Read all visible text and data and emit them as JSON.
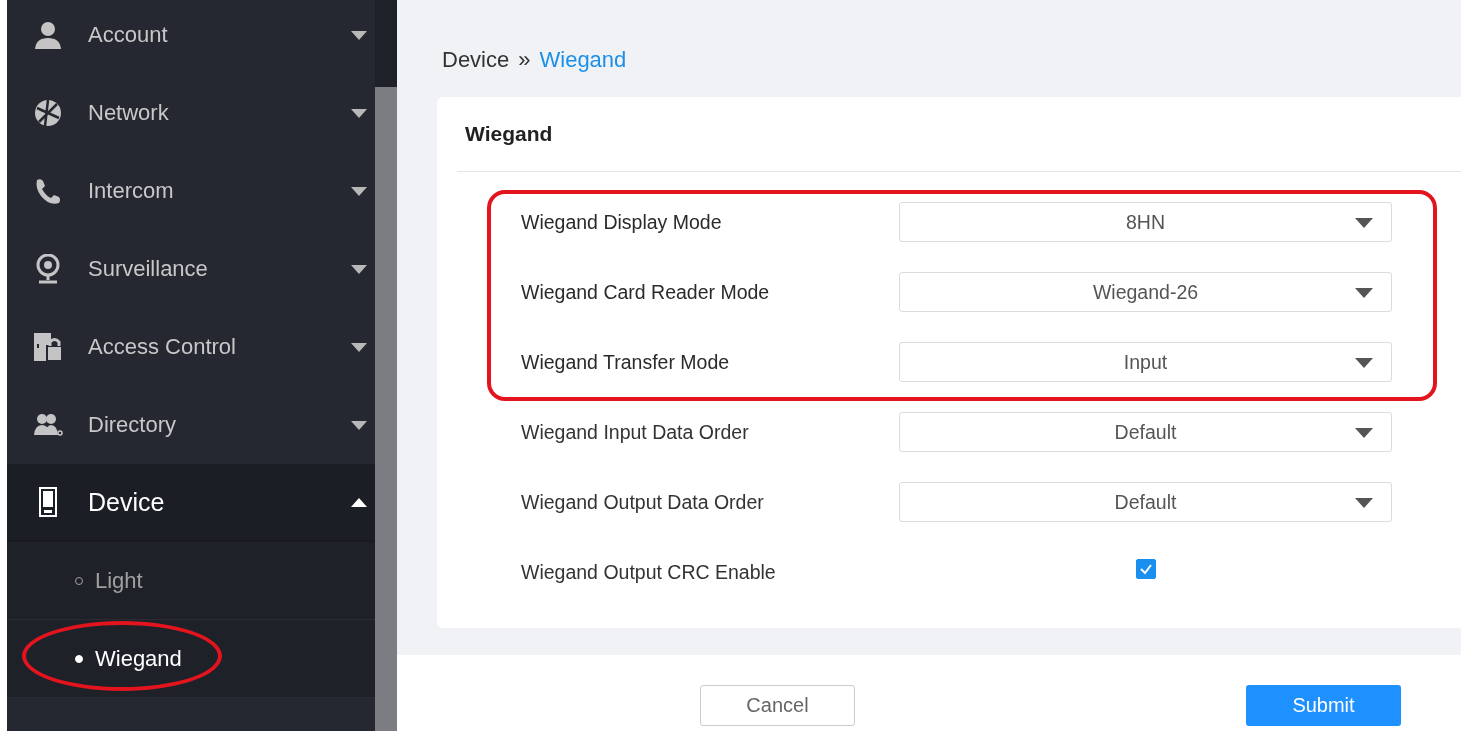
{
  "sidebar": {
    "items": [
      {
        "label": "Account",
        "expanded": false
      },
      {
        "label": "Network",
        "expanded": false
      },
      {
        "label": "Intercom",
        "expanded": false
      },
      {
        "label": "Surveillance",
        "expanded": false
      },
      {
        "label": "Access Control",
        "expanded": false
      },
      {
        "label": "Directory",
        "expanded": false
      },
      {
        "label": "Device",
        "expanded": true,
        "children": [
          {
            "label": "Light",
            "selected": false,
            "circled": false
          },
          {
            "label": "Wiegand",
            "selected": true,
            "circled": true
          }
        ]
      }
    ]
  },
  "breadcrumb": {
    "parent": "Device",
    "separator": "»",
    "current": "Wiegand"
  },
  "card": {
    "title": "Wiegand",
    "rows": [
      {
        "label": "Wiegand Display Mode",
        "kind": "select",
        "value": "8HN",
        "highlighted": true
      },
      {
        "label": "Wiegand Card Reader Mode",
        "kind": "select",
        "value": "Wiegand-26",
        "highlighted": true
      },
      {
        "label": "Wiegand Transfer Mode",
        "kind": "select",
        "value": "Input",
        "highlighted": true
      },
      {
        "label": "Wiegand Input Data Order",
        "kind": "select",
        "value": "Default",
        "highlighted": false
      },
      {
        "label": "Wiegand Output Data Order",
        "kind": "select",
        "value": "Default",
        "highlighted": false
      },
      {
        "label": "Wiegand Output CRC Enable",
        "kind": "checkbox",
        "checked": true,
        "highlighted": false
      }
    ]
  },
  "buttons": [
    {
      "label": "Cancel",
      "kind": "secondary"
    },
    {
      "label": "Submit",
      "kind": "primary"
    }
  ]
}
